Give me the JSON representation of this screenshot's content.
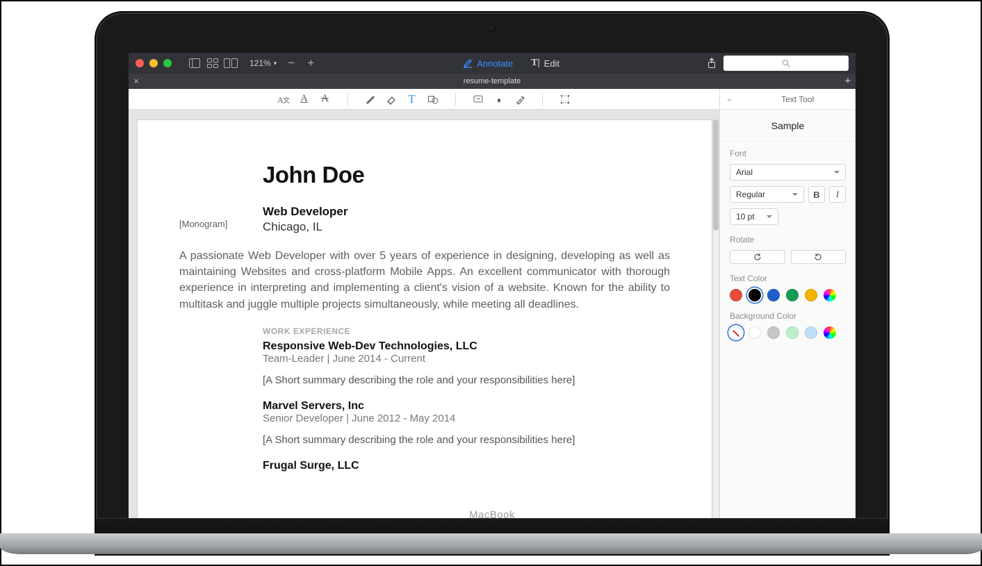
{
  "toolbar": {
    "zoom": "121%",
    "mode_annotate": "Annotate",
    "mode_edit": "Edit",
    "search_placeholder": ""
  },
  "tabbar": {
    "doc_title": "resume-template"
  },
  "resume": {
    "monogram_label": "[Monogram]",
    "name": "John Doe",
    "role": "Web Developer",
    "city": "Chicago, IL",
    "summary": "A passionate Web Developer with over 5 years of experience in designing, developing as well as maintaining Websites and cross-platform Mobile Apps. An excellent communicator with thorough experience in interpreting and implementing a client's vision of a website. Known for the ability to multitask and juggle multiple projects simultaneously, while meeting all deadlines.",
    "section_title": "WORK EXPERIENCE",
    "jobs": [
      {
        "company": "Responsive Web-Dev Technologies, LLC",
        "subtitle": "Team-Leader | June 2014 - Current",
        "desc": "[A Short summary describing the role and your responsibilities here]"
      },
      {
        "company": "Marvel Servers, Inc",
        "subtitle": "Senior Developer | June 2012 - May 2014",
        "desc": "[A Short summary describing the role and your responsibilities here]"
      },
      {
        "company": "Frugal Surge, LLC",
        "subtitle": "",
        "desc": ""
      }
    ]
  },
  "sidebar": {
    "panel_title": "Text Tool",
    "sample": "Sample",
    "labels": {
      "font": "Font",
      "rotate": "Rotate",
      "text_color": "Text Color",
      "bg_color": "Background Color"
    },
    "font_family": "Arial",
    "font_style": "Regular",
    "font_size": "10 pt",
    "text_colors": [
      {
        "name": "red",
        "hex": "#e74c3c",
        "selected": false
      },
      {
        "name": "black",
        "hex": "#000000",
        "selected": true
      },
      {
        "name": "blue",
        "hex": "#1f5fcb",
        "selected": false
      },
      {
        "name": "green",
        "hex": "#159a52",
        "selected": false
      },
      {
        "name": "yellow",
        "hex": "#f2b200",
        "selected": false
      },
      {
        "name": "rainbow",
        "hex": "rainbow",
        "selected": false
      }
    ],
    "bg_colors": [
      {
        "name": "none",
        "hex": "none",
        "selected": true
      },
      {
        "name": "white",
        "hex": "#ffffff",
        "selected": false
      },
      {
        "name": "gray",
        "hex": "#c7c7c7",
        "selected": false
      },
      {
        "name": "mint",
        "hex": "#bdf0c8",
        "selected": false
      },
      {
        "name": "lightblue",
        "hex": "#bfe0f6",
        "selected": false
      },
      {
        "name": "rainbow",
        "hex": "rainbow",
        "selected": false
      }
    ]
  }
}
